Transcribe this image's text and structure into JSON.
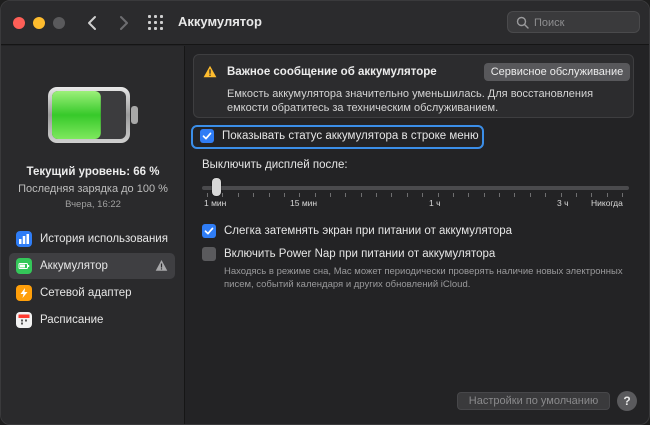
{
  "window": {
    "title": "Аккумулятор",
    "search": {
      "placeholder": "Поиск",
      "value": ""
    }
  },
  "sidebar": {
    "level_label": "Текущий уровень: 66 %",
    "last_charge": "Последняя зарядка до 100 %",
    "charge_time": "Вчера, 16:22",
    "battery_level": 0.66,
    "items": [
      {
        "label": "История использования",
        "icon": "chart-icon",
        "color": "#2f7df6"
      },
      {
        "label": "Аккумулятор",
        "icon": "battery-icon",
        "color": "#34c759",
        "active": true,
        "warning": true
      },
      {
        "label": "Сетевой адаптер",
        "icon": "lightning-icon",
        "color": "#ff9f0a"
      },
      {
        "label": "Расписание",
        "icon": "calendar-icon",
        "color": "#ff3b30"
      }
    ]
  },
  "notice": {
    "title": "Важное сообщение об аккумуляторе",
    "button": "Сервисное обслуживание",
    "body": "Емкость аккумулятора значительно уменьшилась. Для восстановления емкости обратитесь за техническим обслуживанием."
  },
  "settings": {
    "show_status": {
      "label": "Показывать статус аккумулятора в строке меню",
      "checked": true
    },
    "display_off": {
      "label": "Выключить дисплей после:",
      "ticks": [
        "1 мин",
        "15 мин",
        "1 ч",
        "3 ч",
        "Никогда"
      ],
      "selected": "1 мин"
    },
    "dim_screen": {
      "label": "Слегка затемнять экран при питании от аккумулятора",
      "checked": true
    },
    "power_nap": {
      "label": "Включить Power Nap при питании от аккумулятора",
      "checked": false,
      "description": "Находясь в режиме сна, Mac может периодически проверять наличие новых электронных писем, событий календаря и других обновлений iCloud."
    }
  },
  "footer": {
    "defaults_button": "Настройки по умолчанию",
    "help_button": "?"
  },
  "colors": {
    "accent": "#2f7df6",
    "battery_green": "#34c759",
    "warning": "#febc2e"
  }
}
